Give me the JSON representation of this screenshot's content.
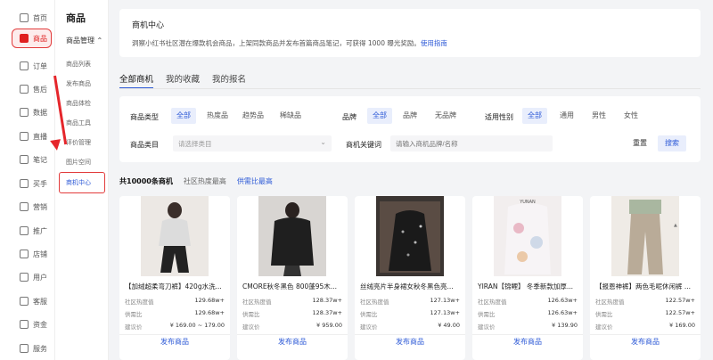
{
  "nav": {
    "items": [
      {
        "label": "首页",
        "icon": "home-icon"
      },
      {
        "label": "商品",
        "icon": "bag-icon",
        "active": true
      },
      {
        "label": "订单",
        "icon": "order-icon"
      },
      {
        "label": "售后",
        "icon": "aftersale-icon"
      },
      {
        "label": "数据",
        "icon": "chart-icon"
      },
      {
        "label": "直播",
        "icon": "live-icon"
      },
      {
        "label": "笔记",
        "icon": "note-icon"
      },
      {
        "label": "买手",
        "icon": "buyer-icon"
      },
      {
        "label": "营销",
        "icon": "marketing-icon"
      },
      {
        "label": "推广",
        "icon": "promotion-icon"
      },
      {
        "label": "店铺",
        "icon": "store-icon"
      },
      {
        "label": "用户",
        "icon": "user-icon"
      },
      {
        "label": "客服",
        "icon": "service-icon"
      },
      {
        "label": "资金",
        "icon": "money-icon"
      },
      {
        "label": "服务",
        "icon": "heart-icon"
      }
    ]
  },
  "submenu": {
    "title": "商品",
    "group": "商品管理 ⌃",
    "items": [
      "商品列表",
      "发布商品",
      "商品体检",
      "商品工具",
      "评价管理",
      "图片空间",
      "商机中心"
    ]
  },
  "banner": {
    "title": "商机中心",
    "desc": "洞察小红书社区潜在爆款机会商品，上架同款商品并发布首篇商品笔记，可获得 1000 曝光奖励。",
    "link": "使用指南"
  },
  "tabs": [
    "全部商机",
    "我的收藏",
    "我的报名"
  ],
  "filters": {
    "type_label": "商品类型",
    "types": [
      "全部",
      "热度品",
      "趋势品",
      "稀缺品"
    ],
    "brand_label": "品牌",
    "brands": [
      "全部",
      "品牌",
      "无品牌"
    ],
    "gender_label": "适用性别",
    "genders": [
      "全部",
      "通用",
      "男性",
      "女性"
    ],
    "category_label": "商品类目",
    "category_placeholder": "请选择类目",
    "keyword_label": "商机关键词",
    "keyword_placeholder": "请输入商机品牌/名称",
    "reset": "重置",
    "search": "搜索"
  },
  "summary": {
    "total": "共10000条商机",
    "sort1": "社区热度最高",
    "sort2": "供需比最高"
  },
  "cards": [
    {
      "title": "【加绒超柔弯刀裤】420g水洗...",
      "heat_label": "社区热度值",
      "heat": "129.68w+",
      "ratio_label": "供需比",
      "ratio": "129.68w+",
      "price_label": "建议价",
      "price": "¥ 169.00 ~ 179.00",
      "action": "发布商品"
    },
    {
      "title": "CMORE秋冬黑色 800蓬95木...",
      "heat_label": "社区热度值",
      "heat": "128.37w+",
      "ratio_label": "供需比",
      "ratio": "128.37w+",
      "price_label": "建议价",
      "price": "¥ 959.00",
      "action": "发布商品"
    },
    {
      "title": "丝绒亮片半身裙女秋冬黑色亮...",
      "heat_label": "社区热度值",
      "heat": "127.13w+",
      "ratio_label": "供需比",
      "ratio": "127.13w+",
      "price_label": "建议价",
      "price": "¥ 49.00",
      "action": "发布商品"
    },
    {
      "title": "YIRAN【锦鲤】 冬季新款加厚...",
      "heat_label": "社区热度值",
      "heat": "126.63w+",
      "ratio_label": "供需比",
      "ratio": "126.63w+",
      "price_label": "建议价",
      "price": "¥ 139.90",
      "action": "发布商品",
      "img_text": "YUNAN"
    },
    {
      "title": "【报恩神裤】两色毛呢休闲裤 ...",
      "heat_label": "社区热度值",
      "heat": "122.57w+",
      "ratio_label": "供需比",
      "ratio": "122.57w+",
      "price_label": "建议价",
      "price": "¥ 169.00",
      "action": "发布商品"
    }
  ]
}
